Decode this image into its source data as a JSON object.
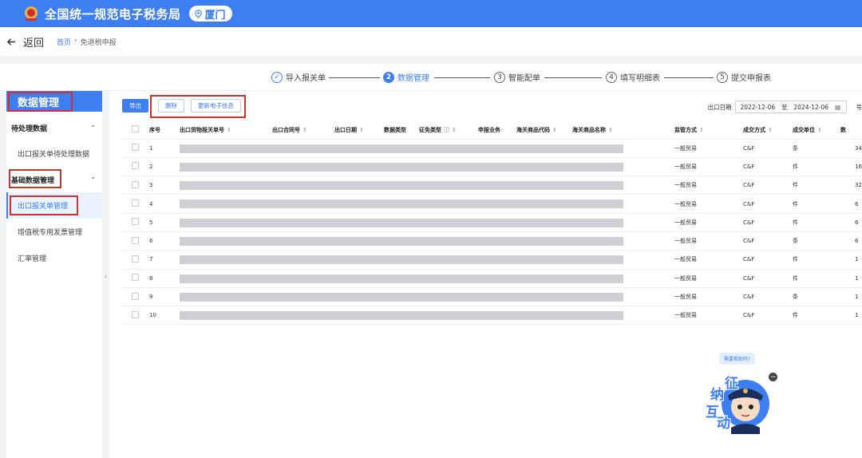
{
  "header": {
    "site_title": "全国统一规范电子税务局",
    "city": "厦门"
  },
  "subheader": {
    "back_label": "返回",
    "breadcrumb_home": "首页",
    "breadcrumb_separator": "›",
    "breadcrumb_current": "免退税申报"
  },
  "stepper": [
    {
      "num": "✓",
      "label": "导入报关单",
      "state": "done"
    },
    {
      "num": "2",
      "label": "数据管理",
      "state": "active"
    },
    {
      "num": "3",
      "label": "智能配单",
      "state": "pending"
    },
    {
      "num": "4",
      "label": "填写明细表",
      "state": "pending"
    },
    {
      "num": "5",
      "label": "提交申报表",
      "state": "pending"
    }
  ],
  "sidebar": {
    "title": "数据管理",
    "group1": "待处理数据",
    "group1_item": "出口报关单待处理数据",
    "group2": "基础数据管理",
    "items": [
      "出口报关单管理",
      "增值税专用发票管理",
      "汇率管理"
    ],
    "chevron_up": "⌃",
    "collapse": "‹"
  },
  "toolbar": {
    "export": "导出",
    "delete": "删除",
    "update": "更新电子信息",
    "date_label": "出口日期",
    "date_from": "2022-12-06",
    "date_to_label": "至",
    "date_to": "2024-12-06",
    "more_label": "号"
  },
  "table": {
    "headers": [
      "序号",
      "出口货物报关单号",
      "出口合同号",
      "出口日期",
      "数据类型",
      "征免类型",
      "申报业务",
      "海关商品代码",
      "海关商品名称",
      "监管方式",
      "成交方式",
      "成交单位",
      "数"
    ],
    "sort_icon": "⇕",
    "info_icon": "ⓘ",
    "rows": [
      {
        "no": "1",
        "supervision": "一般贸易",
        "trade": "C&F",
        "unit": "条",
        "qty": "34"
      },
      {
        "no": "2",
        "supervision": "一般贸易",
        "trade": "C&F",
        "unit": "件",
        "qty": "16"
      },
      {
        "no": "3",
        "supervision": "一般贸易",
        "trade": "C&F",
        "unit": "件",
        "qty": "32"
      },
      {
        "no": "4",
        "supervision": "一般贸易",
        "trade": "C&F",
        "unit": "件",
        "qty": "6"
      },
      {
        "no": "5",
        "supervision": "一般贸易",
        "trade": "C&F",
        "unit": "件",
        "qty": "6"
      },
      {
        "no": "6",
        "supervision": "一般贸易",
        "trade": "C&F",
        "unit": "条",
        "qty": "6"
      },
      {
        "no": "7",
        "supervision": "一般贸易",
        "trade": "C&F",
        "unit": "件",
        "qty": "1"
      },
      {
        "no": "8",
        "supervision": "一般贸易",
        "trade": "C&F",
        "unit": "件",
        "qty": "1"
      },
      {
        "no": "9",
        "supervision": "一般贸易",
        "trade": "C&F",
        "unit": "条",
        "qty": "1"
      },
      {
        "no": "10",
        "supervision": "一般贸易",
        "trade": "C&F",
        "unit": "件",
        "qty": "1"
      }
    ]
  },
  "assistant": {
    "bubble": "需要帮助吗?",
    "chars": [
      "征",
      "纳",
      "互",
      "动"
    ],
    "close": "−"
  },
  "colors": {
    "primary": "#3d7ff3",
    "annotation": "#d0312d",
    "mask": "#cfd0d3"
  }
}
